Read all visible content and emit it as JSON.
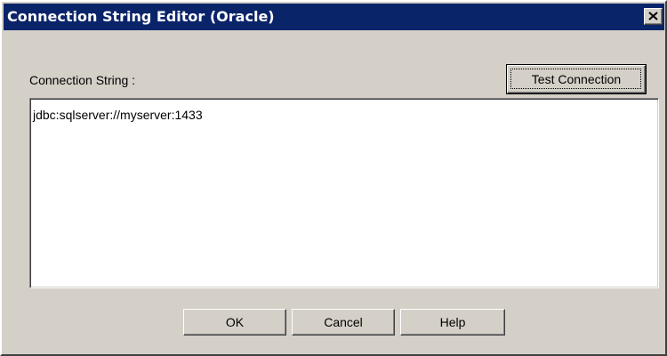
{
  "window": {
    "title": "Connection String Editor (Oracle)",
    "close_icon": "close-icon"
  },
  "form": {
    "connection_string_label": "Connection String :",
    "connection_string_value": "jdbc:sqlserver://myserver:1433",
    "test_connection_label": "Test Connection"
  },
  "footer": {
    "ok_label": "OK",
    "cancel_label": "Cancel",
    "help_label": "Help"
  },
  "colors": {
    "titlebar": "#0a246a",
    "dialog_face": "#d4d0c8",
    "text_area_background": "#ffffff"
  }
}
